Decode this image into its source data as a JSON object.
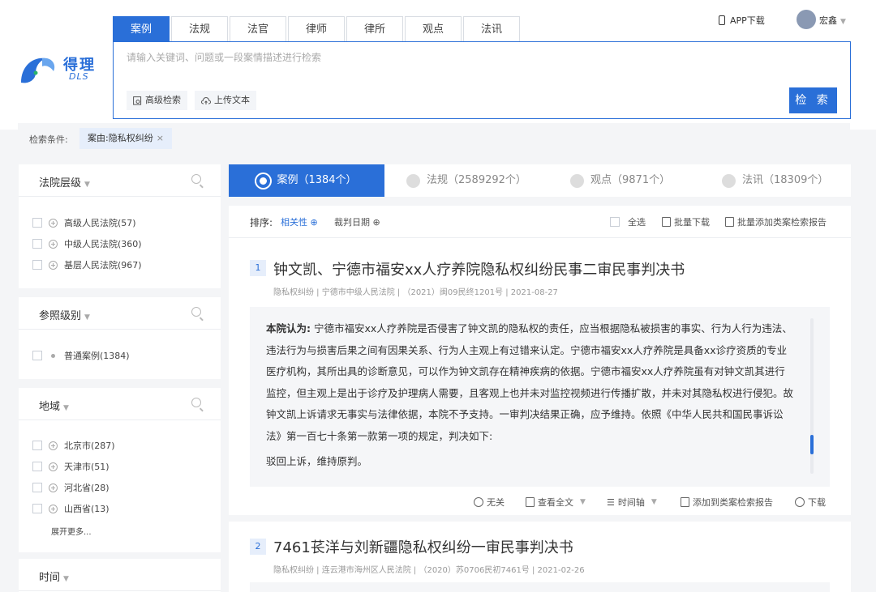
{
  "brand": {
    "name_cn": "得理",
    "name_en": "DLS",
    "accent": "#2a6fd8"
  },
  "top_tabs": [
    {
      "label": "案例"
    },
    {
      "label": "法规"
    },
    {
      "label": "法官"
    },
    {
      "label": "律师"
    },
    {
      "label": "律所"
    },
    {
      "label": "观点"
    },
    {
      "label": "法讯"
    }
  ],
  "header": {
    "app_download": "APP下载",
    "username": "宏鑫",
    "avatar_icon": "avatar"
  },
  "search": {
    "placeholder": "请输入关键词、问题或一段案情描述进行检索",
    "value": "",
    "advanced_label": "高级检索",
    "upload_label": "上传文本",
    "submit_label": "检 索"
  },
  "filters": {
    "label": "检索条件:",
    "chips": [
      {
        "label": "案由:隐私权纠纷"
      }
    ]
  },
  "facets": [
    {
      "title": "法院层级",
      "items": [
        {
          "label": "高级人民法院(57)"
        },
        {
          "label": "中级人民法院(360)"
        },
        {
          "label": "基层人民法院(967)"
        }
      ]
    },
    {
      "title": "参照级别",
      "items": [
        {
          "label": "普通案例(1384)"
        }
      ]
    },
    {
      "title": "地域",
      "items": [
        {
          "label": "北京市(287)"
        },
        {
          "label": "天津市(51)"
        },
        {
          "label": "河北省(28)"
        },
        {
          "label": "山西省(13)"
        }
      ],
      "expand_label": "展开更多..."
    },
    {
      "title": "时间",
      "items": []
    }
  ],
  "type_tabs": [
    {
      "label": "案例（1384个）"
    },
    {
      "label": "法规（2589292个）"
    },
    {
      "label": "观点（9871个）"
    },
    {
      "label": "法讯（18309个）"
    }
  ],
  "sort": {
    "label": "排序:",
    "options": [
      {
        "label": "相关性"
      },
      {
        "label": "裁判日期"
      }
    ],
    "select_all": "全选",
    "batch_download": "批量下载",
    "batch_add_report": "批量添加类案检索报告"
  },
  "results": [
    {
      "index": "1",
      "title": "钟文凯、宁德市福安xx人疗养院隐私权纠纷民事二审民事判决书",
      "meta": "隐私权纠纷 | 宁德市中级人民法院 | （2021）闽09民终1201号 | 2021-08-27",
      "opinion_label": "本院认为:",
      "opinion": "宁德市福安xx人疗养院是否侵害了钟文凯的隐私权的责任，应当根据隐私被损害的事实、行为人行为违法、违法行为与损害后果之间有因果关系、行为人主观上有过错来认定。宁德市福安xx人疗养院是具备xx诊疗资质的专业医疗机构，其所出具的诊断意见，可以作为钟文凯存在精神疾病的依据。宁德市福安xx人疗养院虽有对钟文凯其进行监控，但主观上是出于诊疗及护理病人需要，且客观上也并未对监控视频进行传播扩散，并未对其隐私权进行侵犯。故钟文凯上诉请求无事实与法律依据，本院不予支持。一审判决结果正确，应予维持。依照《中华人民共和国民事诉讼法》第一百七十条第一款第一项的规定，判决如下:",
      "verdict": "驳回上诉，维持原判。",
      "actions": {
        "irrelevant": "无关",
        "view_full": "查看全文",
        "timeline": "时间轴",
        "add_report": "添加到类案检索报告",
        "download": "下载"
      }
    },
    {
      "index": "2",
      "title": "7461苌洋与刘新疆隐私权纠纷一审民事判决书",
      "meta": "隐私权纠纷 | 连云港市海州区人民法院 | （2020）苏0706民初7461号 | 2021-02-26"
    }
  ]
}
